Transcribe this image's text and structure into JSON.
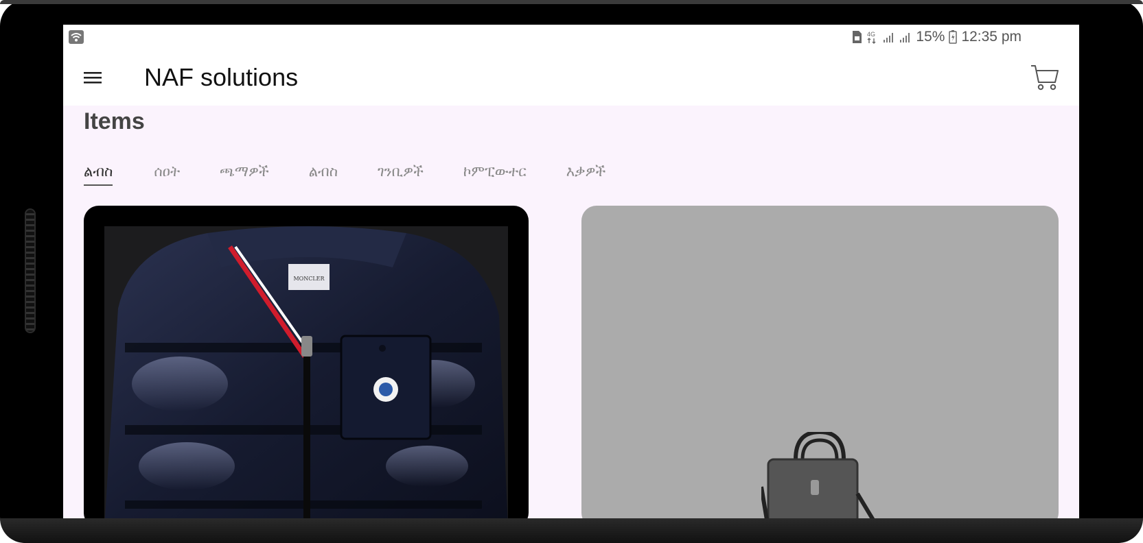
{
  "status_bar": {
    "battery": "15%",
    "time": "12:35 pm",
    "network": "4G",
    "icons": [
      "wifi-icon",
      "sim-icon",
      "network-4g-icon",
      "signal-icon",
      "signal-icon",
      "battery-icon"
    ]
  },
  "app_bar": {
    "title": "NAF solutions",
    "menu_icon": "hamburger-menu-icon",
    "cart_icon": "shopping-cart-icon"
  },
  "section": {
    "title": "Items"
  },
  "tabs": [
    {
      "label": "ልብስ",
      "active": true
    },
    {
      "label": "ሰዐት",
      "active": false
    },
    {
      "label": "ጫማዎች",
      "active": false
    },
    {
      "label": "ልብስ",
      "active": false
    },
    {
      "label": "ገንቢዎች",
      "active": false
    },
    {
      "label": "ኮምፒውተር",
      "active": false
    },
    {
      "label": "እቃዎች",
      "active": false
    }
  ],
  "products": [
    {
      "image": "puffer-jacket-photo",
      "label_on_item": "MONCLER"
    },
    {
      "image": "gray-briefcase-bag-photo"
    }
  ],
  "colors": {
    "screen_background": "#fbf3fd",
    "tab_active": "#333333",
    "tab_inactive": "#8a8a8a",
    "bag_card_background": "#ababab"
  }
}
